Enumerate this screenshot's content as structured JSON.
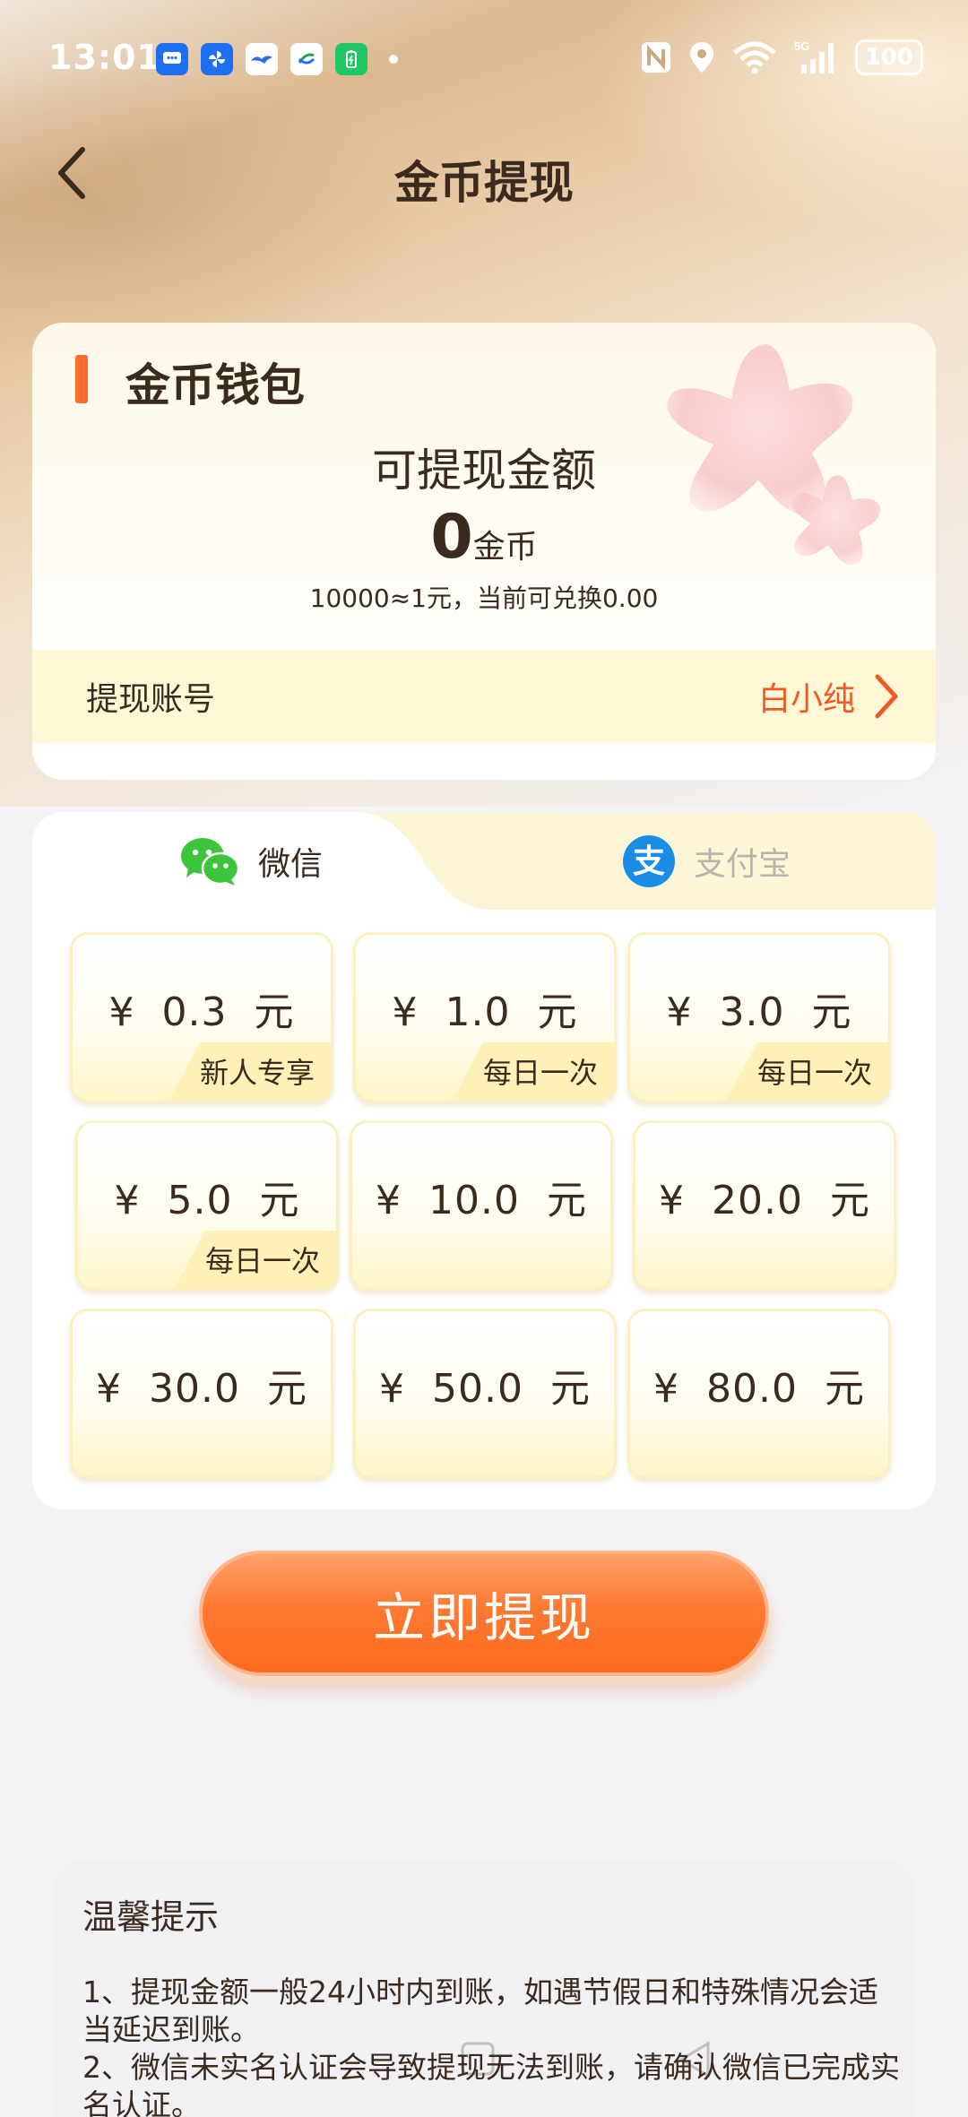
{
  "status_bar": {
    "time": "13:01",
    "notifications": [
      {
        "icon": "message-app-icon",
        "color": "#1f6ff2"
      },
      {
        "icon": "pinwheel-app-icon",
        "color": "#1f6ff2"
      },
      {
        "icon": "bird-app-icon",
        "color": "#2e6be6"
      },
      {
        "icon": "china-mobile-icon",
        "color": "#ffffff"
      },
      {
        "icon": "battery-saver-icon",
        "color": "#1fc764"
      }
    ],
    "system_icons": [
      "nfc-icon",
      "location-icon",
      "wifi-icon",
      "signal-5g-icon"
    ],
    "battery": "100"
  },
  "header": {
    "title": "金币提现"
  },
  "wallet": {
    "title": "金币钱包",
    "withdrawable_label": "可提现金额",
    "coins": "0",
    "coins_unit": "金币",
    "rate_text": "10000≈1元，当前可兑换0.00",
    "account_label": "提现账号",
    "account_name": "白小纯"
  },
  "methods": {
    "tabs": [
      {
        "label": "微信",
        "active": true
      },
      {
        "label": "支付宝",
        "active": false
      }
    ],
    "amounts": [
      {
        "value": "¥  0.3  元",
        "tag": "新人专享"
      },
      {
        "value": "¥  1.0  元",
        "tag": "每日一次"
      },
      {
        "value": "¥  3.0  元",
        "tag": "每日一次"
      },
      {
        "value": "¥  5.0  元",
        "tag": "每日一次"
      },
      {
        "value": "¥  10.0  元",
        "tag": ""
      },
      {
        "value": "¥  20.0  元",
        "tag": ""
      },
      {
        "value": "¥  30.0  元",
        "tag": ""
      },
      {
        "value": "¥  50.0  元",
        "tag": ""
      },
      {
        "value": "¥  80.0  元",
        "tag": ""
      }
    ]
  },
  "withdraw_button": "立即提现",
  "tips": {
    "title": "温馨提示",
    "items": [
      "1、提现金额一般24小时内到账，如遇节假日和特殊情况会适当延迟到账。",
      "2、微信未实名认证会导致提现无法到账，请确认微信已完成实名认证。"
    ]
  },
  "colors": {
    "accent": "#ff6b2c",
    "account_name": "#f05a22",
    "tag_bg": "#fff1b8"
  }
}
